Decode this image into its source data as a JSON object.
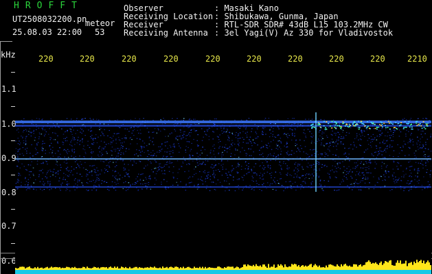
{
  "header": {
    "brand": "HROFFT",
    "file_name": "UT2508032200.pn",
    "meteor_label": "meteor",
    "date_time": "25.08.03 22:00",
    "count": "53",
    "fields": [
      {
        "label": "Observer",
        "value": ": Masaki Kano"
      },
      {
        "label": "Receiving Location",
        "value": ": Shibukawa, Gunma, Japan"
      },
      {
        "label": "Receiver",
        "value": ": RTL-SDR SDR# 43dB L15 103.2MHz CW"
      },
      {
        "label": "Receiving Antenna",
        "value": ": 3el Yagi(V) Az 330 for Vladivostok"
      }
    ]
  },
  "axis": {
    "y_unit": "kHz",
    "y_ticks": [
      "1.1",
      "1.0",
      "0.9",
      "0.8",
      "0.7",
      "0.6"
    ],
    "time_ticks": [
      "220",
      "220",
      "220",
      "220",
      "220",
      "220",
      "220",
      "220",
      "220",
      "2210"
    ]
  },
  "colors": {
    "background": "#000000",
    "brand": "#2bd63c",
    "time_ticks": "#e7e74a",
    "signal": "#1e3cff",
    "lower_band": "#19c9e6",
    "spike": "#ffe61a"
  }
}
